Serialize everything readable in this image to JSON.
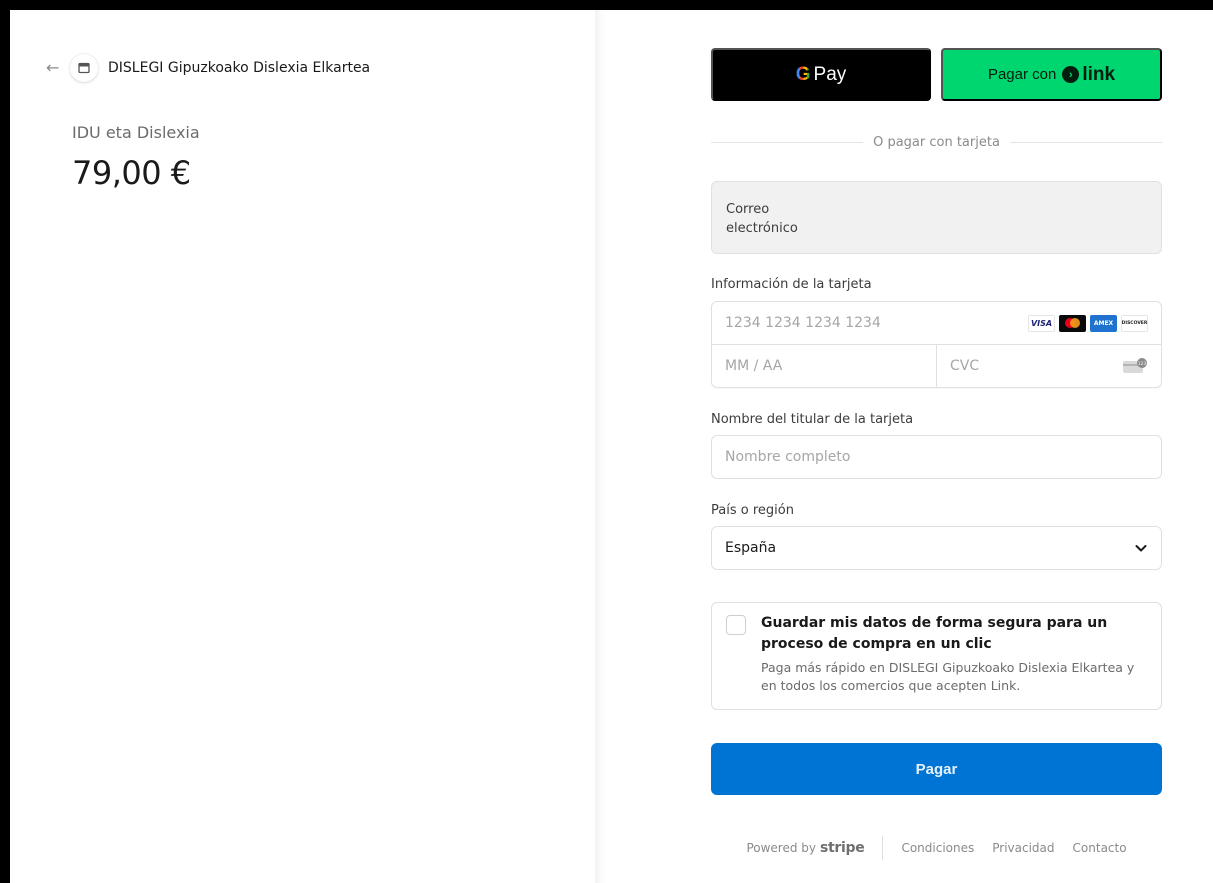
{
  "merchant": {
    "name": "DISLEGI Gipuzkoako Dislexia Elkartea"
  },
  "product": {
    "name": "IDU eta Dislexia",
    "amount": "79,00 €"
  },
  "wallets": {
    "gpay_text": "Pay",
    "link_prefix": "Pagar con",
    "link_brand": "link"
  },
  "divider_text": "O pagar con tarjeta",
  "email": {
    "label": "Correo electrónico"
  },
  "card": {
    "label": "Información de la tarjeta",
    "number_placeholder": "1234 1234 1234 1234",
    "expiry_placeholder": "MM / AA",
    "cvc_placeholder": "CVC",
    "brands": [
      "VISA",
      "Mastercard",
      "AMEX",
      "DISCOVER"
    ]
  },
  "cardholder": {
    "label": "Nombre del titular de la tarjeta",
    "placeholder": "Nombre completo"
  },
  "country": {
    "label": "País o región",
    "selected": "España"
  },
  "save_info": {
    "title": "Guardar mis datos de forma segura para un proceso de compra en un clic",
    "description": "Paga más rápido en DISLEGI Gipuzkoako Dislexia Elkartea y en todos los comercios que acepten Link."
  },
  "pay_button": "Pagar",
  "footer": {
    "powered_by": "Powered by",
    "stripe": "stripe",
    "links": [
      "Condiciones",
      "Privacidad",
      "Contacto"
    ]
  },
  "colors": {
    "pay_button": "#0074d4",
    "link_button": "#00d66f",
    "gpay_button": "#000000"
  }
}
